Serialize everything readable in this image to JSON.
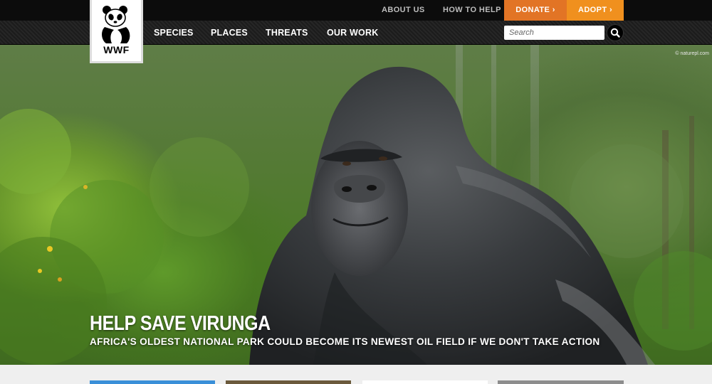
{
  "header": {
    "utility_links": [
      "ABOUT US",
      "HOW TO HELP"
    ],
    "donate_label": "DONATE ›",
    "adopt_label": "ADOPT ›",
    "logo_text": "WWF"
  },
  "nav": {
    "items": [
      "SPECIES",
      "PLACES",
      "THREATS",
      "OUR WORK"
    ]
  },
  "search": {
    "placeholder": "Search",
    "icon": "search-icon"
  },
  "hero": {
    "photo_credit": "© naturepl.com",
    "title": "HELP SAVE VIRUNGA",
    "subtitle": "AFRICA'S OLDEST NATIONAL PARK COULD BECOME ITS NEWEST OIL FIELD IF WE DON'T TAKE ACTION"
  },
  "colors": {
    "donate": "#e27425",
    "adopt": "#f0901e",
    "topbar": "#0c0c0c"
  }
}
